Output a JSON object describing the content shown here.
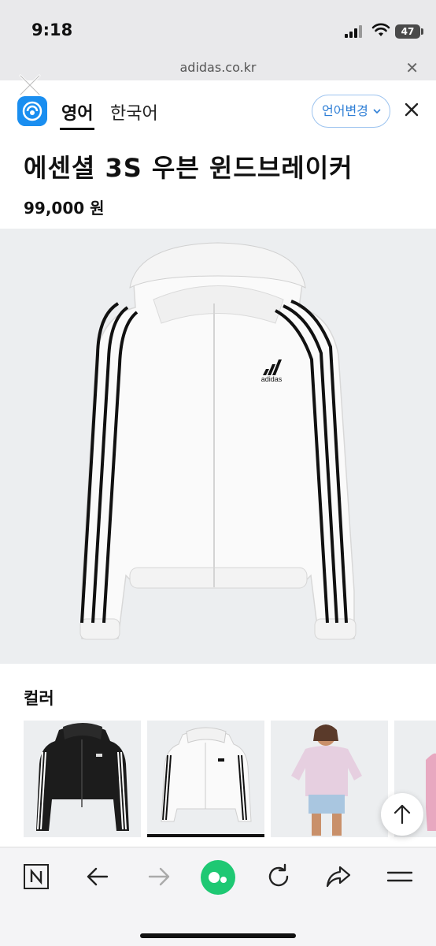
{
  "status": {
    "time": "9:18",
    "battery": "47"
  },
  "browser": {
    "url": "adidas.co.kr"
  },
  "translate": {
    "tab_source": "영어",
    "tab_target": "한국어",
    "change_language": "언어변경"
  },
  "product": {
    "title": "에센셜 3S 우븐 윈드브레이커",
    "price": "99,000 원",
    "image_brand": "adidas"
  },
  "colors": {
    "heading": "컬러",
    "options": [
      {
        "name": "black",
        "selected": false
      },
      {
        "name": "white",
        "selected": true
      },
      {
        "name": "pink",
        "selected": false
      },
      {
        "name": "pink-alt",
        "selected": false
      }
    ]
  },
  "toolbar": {
    "icons": [
      "naver-n-icon",
      "back-arrow-icon",
      "forward-arrow-icon",
      "green-dot-icon",
      "refresh-icon",
      "share-icon",
      "menu-icon"
    ]
  },
  "accent": {
    "translate_blue": "#1a8ef0",
    "link_blue": "#2f7fd6",
    "green": "#1ec873"
  }
}
